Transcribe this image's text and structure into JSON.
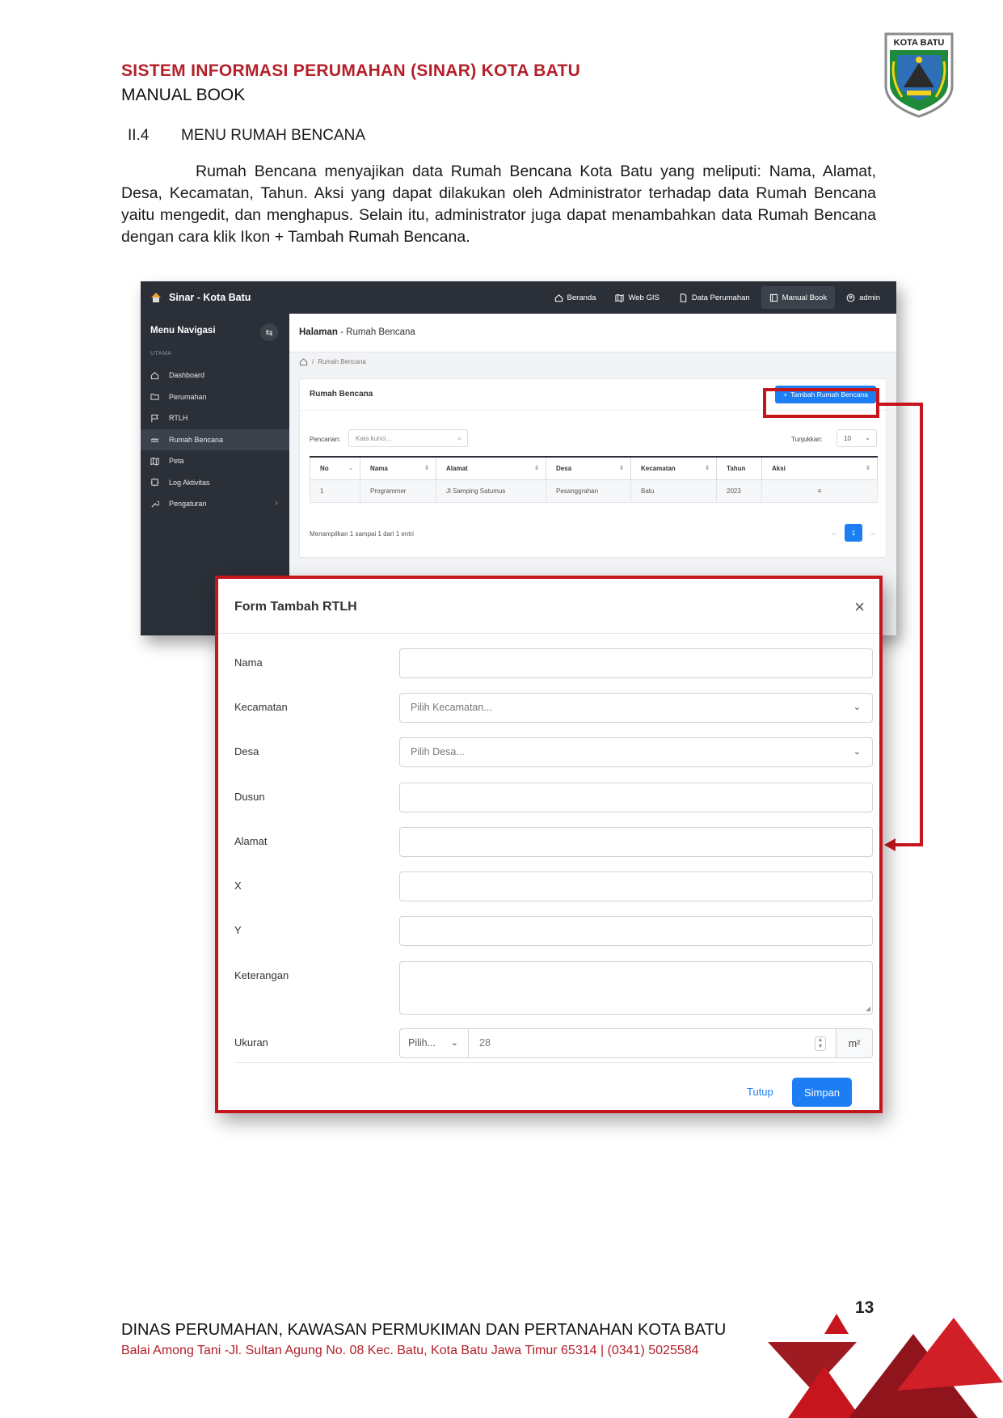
{
  "doc": {
    "title": "SISTEM INFORMASI PERUMAHAN (SINAR) KOTA BATU",
    "subtitle": "MANUAL BOOK",
    "logo_text": "KOTA BATU",
    "section_number": "II.4",
    "section_title": "MENU RUMAH BENCANA",
    "intro": "Rumah Bencana menyajikan data Rumah Bencana Kota Batu yang meliputi: Nama, Alamat, Desa, Kecamatan, Tahun. Aksi yang dapat dilakukan oleh Administrator terhadap data Rumah Bencana yaitu mengedit, dan menghapus. Selain itu, administrator juga dapat menambahkan data Rumah Bencana dengan cara klik Ikon + Tambah Rumah Bencana."
  },
  "app": {
    "brand": "Sinar - Kota Batu",
    "topnav": [
      {
        "label": "Beranda",
        "icon": "home-icon"
      },
      {
        "label": "Web GIS",
        "icon": "map-icon"
      },
      {
        "label": "Data Perumahan",
        "icon": "file-icon"
      },
      {
        "label": "Manual Book",
        "icon": "book-icon"
      },
      {
        "label": "admin",
        "icon": "user-icon"
      }
    ],
    "sidebar": {
      "title": "Menu Navigasi",
      "section": "UTAMA",
      "items": [
        {
          "label": "Dashboard",
          "icon": "home-icon"
        },
        {
          "label": "Perumahan",
          "icon": "folder-icon"
        },
        {
          "label": "RTLH",
          "icon": "flag-icon"
        },
        {
          "label": "Rumah Bencana",
          "icon": "broken-house-icon"
        },
        {
          "label": "Peta",
          "icon": "map-icon"
        },
        {
          "label": "Log Aktivitas",
          "icon": "activity-icon"
        },
        {
          "label": "Pengaturan",
          "icon": "tool-icon"
        }
      ]
    },
    "page_head_prefix": "Halaman",
    "page_head_name": " - Rumah Bencana",
    "breadcrumb": "Rumah Bencana",
    "card_title": "Rumah Bencana",
    "add_button": "Tambah Rumah Bencana",
    "search_label": "Pencarian:",
    "search_placeholder": "Kata kunci...",
    "show_label": "Tunjukkan:",
    "show_value": "10",
    "table": {
      "headers": [
        "No",
        "Nama",
        "Alamat",
        "Desa",
        "Kecamatan",
        "Tahun",
        "Aksi"
      ],
      "rows": [
        [
          "1",
          "Programmer",
          "Jl Samping Satumus",
          "Pesanggrahan",
          "Batu",
          "2023"
        ]
      ]
    },
    "table_info": "Menampilkan 1 sampai 1 dari 1 entri",
    "page_current": "1"
  },
  "form": {
    "title": "Form Tambah RTLH",
    "fields": {
      "nama": "Nama",
      "kecamatan": "Kecamatan",
      "kecamatan_placeholder": "Pilih Kecamatan...",
      "desa": "Desa",
      "desa_placeholder": "Pilih Desa...",
      "dusun": "Dusun",
      "alamat": "Alamat",
      "x": "X",
      "y": "Y",
      "keterangan": "Keterangan",
      "ukuran": "Ukuran",
      "ukuran_select": "Pilih...",
      "ukuran_value": "28",
      "ukuran_unit": "m²"
    },
    "cancel": "Tutup",
    "save": "Simpan"
  },
  "footer": {
    "page_number": "13",
    "org": "DINAS PERUMAHAN, KAWASAN PERMUKIMAN DAN PERTANAHAN KOTA BATU",
    "address": "Balai Among Tani -Jl. Sultan Agung No. 08 Kec. Batu, Kota Batu Jawa Timur 65314 | (0341) 5025584"
  },
  "colors": {
    "brand_red": "#b3202a",
    "highlight_red": "#c7151d",
    "primary_blue": "#1c7ef2",
    "sidebar_dark": "#2b3038"
  }
}
